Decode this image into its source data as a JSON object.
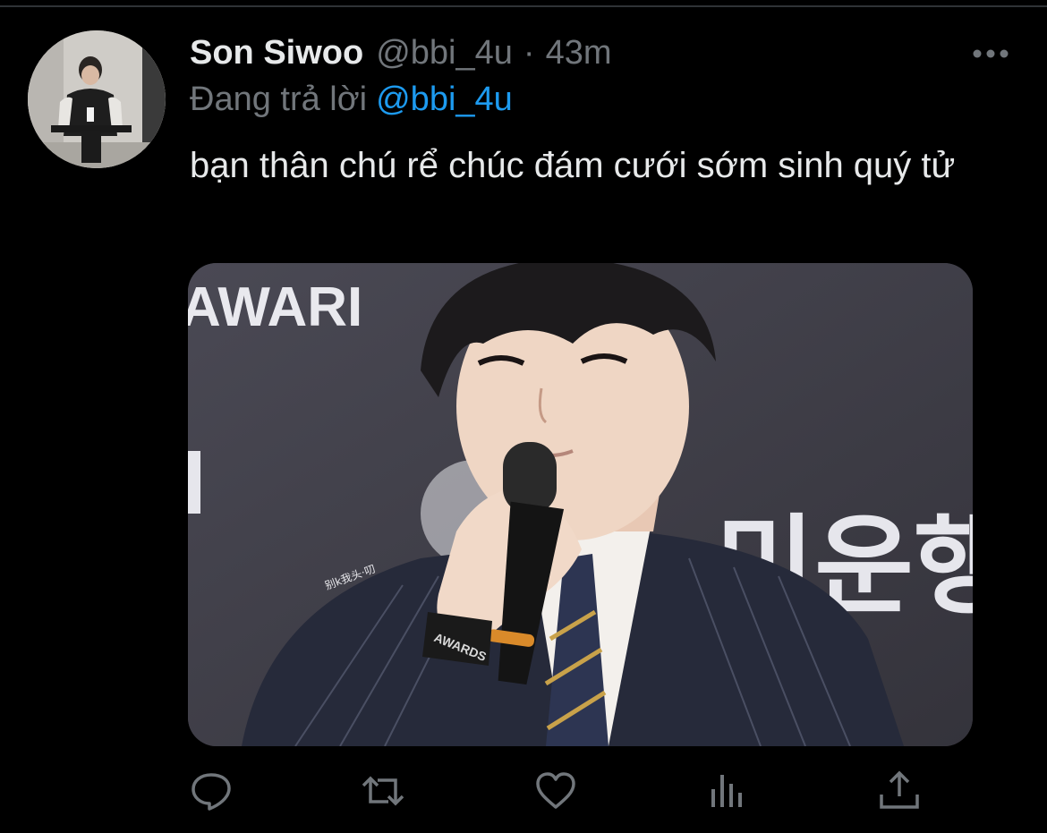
{
  "tweet": {
    "author_name": "Son Siwoo",
    "handle": "@bbi_4u",
    "separator": "·",
    "time": "43m",
    "replying_label": "Đang trả lời",
    "replying_to": "@bbi_4u",
    "text": "bạn thân chú rể chúc đám cưới sớm sinh quý tử"
  },
  "media": {
    "bg_text_award": "AWARI",
    "bg_text_korean": "민운행",
    "watermark": "别k我头·叨",
    "wristband_text": "AWARDS"
  },
  "actions": {
    "reply_icon": "reply-icon",
    "retweet_icon": "retweet-icon",
    "like_icon": "heart-icon",
    "analytics_icon": "analytics-icon",
    "share_icon": "share-icon"
  },
  "colors": {
    "background": "#000000",
    "text_primary": "#e7e9ea",
    "text_secondary": "#71767b",
    "accent": "#1d9bf0"
  }
}
